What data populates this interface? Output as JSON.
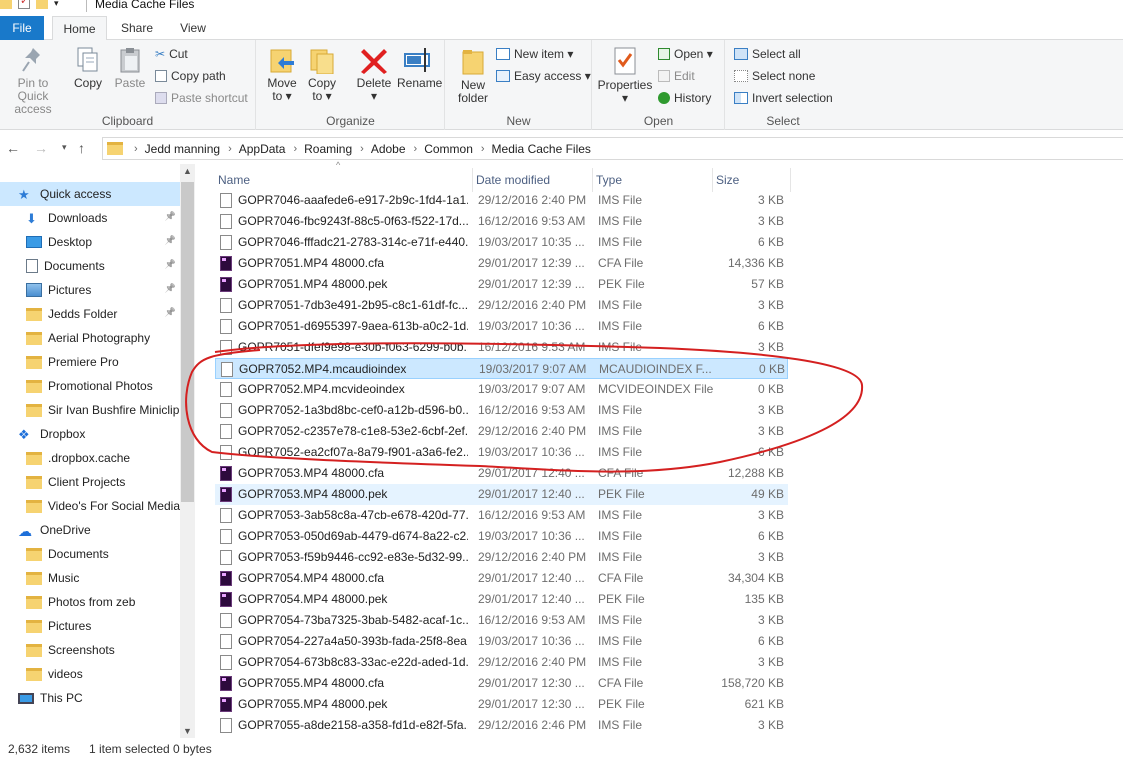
{
  "window": {
    "title": "Media Cache Files"
  },
  "ribbon_tabs": [
    "File",
    "Home",
    "Share",
    "View"
  ],
  "clipboard": {
    "pin_label_1": "Pin to Quick",
    "pin_label_2": "access",
    "copy": "Copy",
    "paste": "Paste",
    "cut": "Cut",
    "copy_path": "Copy path",
    "paste_shortcut": "Paste shortcut",
    "group": "Clipboard"
  },
  "organize": {
    "move_1": "Move",
    "move_2": "to ▾",
    "copy_1": "Copy",
    "copy_2": "to ▾",
    "delete_1": "Delete",
    "delete_2": "▾",
    "rename": "Rename",
    "group": "Organize"
  },
  "new": {
    "new_folder_1": "New",
    "new_folder_2": "folder",
    "new_item": "New item ▾",
    "easy_access": "Easy access ▾",
    "group": "New"
  },
  "open": {
    "properties": "Properties",
    "properties_2": "▾",
    "open": "Open ▾",
    "edit": "Edit",
    "history": "History",
    "group": "Open"
  },
  "select": {
    "select_all": "Select all",
    "select_none": "Select none",
    "invert": "Invert selection",
    "group": "Select"
  },
  "breadcrumb": [
    "Jedd manning",
    "AppData",
    "Roaming",
    "Adobe",
    "Common",
    "Media Cache Files"
  ],
  "sidebar": [
    {
      "label": "Quick access",
      "icon": "star-icon",
      "selected": true,
      "pinned": false
    },
    {
      "label": "Downloads",
      "icon": "download-icon",
      "pinned": true
    },
    {
      "label": "Desktop",
      "icon": "desktop-icon",
      "pinned": true
    },
    {
      "label": "Documents",
      "icon": "documents-icon",
      "pinned": true
    },
    {
      "label": "Pictures",
      "icon": "pictures-icon",
      "pinned": true
    },
    {
      "label": "Jedds Folder",
      "icon": "folder-icon",
      "pinned": true
    },
    {
      "label": "Aerial Photography",
      "icon": "folder-icon"
    },
    {
      "label": "Premiere Pro",
      "icon": "folder-icon"
    },
    {
      "label": "Promotional Photos",
      "icon": "folder-icon"
    },
    {
      "label": "Sir Ivan Bushfire Miniclip",
      "icon": "folder-icon"
    },
    {
      "label": "Dropbox",
      "icon": "dropbox-icon",
      "root": true
    },
    {
      "label": ".dropbox.cache",
      "icon": "folder-icon"
    },
    {
      "label": "Client Projects",
      "icon": "folder-icon"
    },
    {
      "label": "Video's For Social Media",
      "icon": "folder-icon"
    },
    {
      "label": "OneDrive",
      "icon": "cloud-icon",
      "root": true
    },
    {
      "label": "Documents",
      "icon": "folder-icon"
    },
    {
      "label": "Music",
      "icon": "folder-icon"
    },
    {
      "label": "Photos from zeb",
      "icon": "folder-icon"
    },
    {
      "label": "Pictures",
      "icon": "folder-icon"
    },
    {
      "label": "Screenshots",
      "icon": "folder-icon"
    },
    {
      "label": "videos",
      "icon": "folder-icon"
    },
    {
      "label": "This PC",
      "icon": "computer-icon",
      "root": true
    }
  ],
  "columns": {
    "name": "Name",
    "date": "Date modified",
    "type": "Type",
    "size": "Size"
  },
  "files": [
    {
      "name": "GOPR7046-aaafede6-e917-2b9c-1fd4-1a1...",
      "date": "29/12/2016 2:40 PM",
      "type": "IMS File",
      "size": "3 KB",
      "icon": "doc"
    },
    {
      "name": "GOPR7046-fbc9243f-88c5-0f63-f522-17d...",
      "date": "16/12/2016 9:53 AM",
      "type": "IMS File",
      "size": "3 KB",
      "icon": "doc"
    },
    {
      "name": "GOPR7046-fffadc21-2783-314c-e71f-e440...",
      "date": "19/03/2017 10:35 ...",
      "type": "IMS File",
      "size": "6 KB",
      "icon": "doc"
    },
    {
      "name": "GOPR7051.MP4 48000.cfa",
      "date": "29/01/2017 12:39 ...",
      "type": "CFA File",
      "size": "14,336 KB",
      "icon": "premiere"
    },
    {
      "name": "GOPR7051.MP4 48000.pek",
      "date": "29/01/2017 12:39 ...",
      "type": "PEK File",
      "size": "57 KB",
      "icon": "premiere"
    },
    {
      "name": "GOPR7051-7db3e491-2b95-c8c1-61df-fc...",
      "date": "29/12/2016 2:40 PM",
      "type": "IMS File",
      "size": "3 KB",
      "icon": "doc"
    },
    {
      "name": "GOPR7051-d6955397-9aea-613b-a0c2-1d...",
      "date": "19/03/2017 10:36 ...",
      "type": "IMS File",
      "size": "6 KB",
      "icon": "doc"
    },
    {
      "name": "GOPR7051-dfef9e98-e30b-f063-6299-b0b...",
      "date": "16/12/2016 9:53 AM",
      "type": "IMS File",
      "size": "3 KB",
      "icon": "doc"
    },
    {
      "name": "GOPR7052.MP4.mcaudioindex",
      "date": "19/03/2017 9:07 AM",
      "type": "MCAUDIOINDEX F...",
      "size": "0 KB",
      "icon": "doc",
      "state": "selected"
    },
    {
      "name": "GOPR7052.MP4.mcvideoindex",
      "date": "19/03/2017 9:07 AM",
      "type": "MCVIDEOINDEX File",
      "size": "0 KB",
      "icon": "doc"
    },
    {
      "name": "GOPR7052-1a3bd8bc-cef0-a12b-d596-b0...",
      "date": "16/12/2016 9:53 AM",
      "type": "IMS File",
      "size": "3 KB",
      "icon": "doc"
    },
    {
      "name": "GOPR7052-c2357e78-c1e8-53e2-6cbf-2ef...",
      "date": "29/12/2016 2:40 PM",
      "type": "IMS File",
      "size": "3 KB",
      "icon": "doc"
    },
    {
      "name": "GOPR7052-ea2cf07a-8a79-f901-a3a6-fe2...",
      "date": "19/03/2017 10:36 ...",
      "type": "IMS File",
      "size": "6 KB",
      "icon": "doc"
    },
    {
      "name": "GOPR7053.MP4 48000.cfa",
      "date": "29/01/2017 12:40 ...",
      "type": "CFA File",
      "size": "12,288 KB",
      "icon": "premiere"
    },
    {
      "name": "GOPR7053.MP4 48000.pek",
      "date": "29/01/2017 12:40 ...",
      "type": "PEK File",
      "size": "49 KB",
      "icon": "premiere",
      "state": "hover"
    },
    {
      "name": "GOPR7053-3ab58c8a-47cb-e678-420d-77...",
      "date": "16/12/2016 9:53 AM",
      "type": "IMS File",
      "size": "3 KB",
      "icon": "doc"
    },
    {
      "name": "GOPR7053-050d69ab-4479-d674-8a22-c2...",
      "date": "19/03/2017 10:36 ...",
      "type": "IMS File",
      "size": "6 KB",
      "icon": "doc"
    },
    {
      "name": "GOPR7053-f59b9446-cc92-e83e-5d32-99...",
      "date": "29/12/2016 2:40 PM",
      "type": "IMS File",
      "size": "3 KB",
      "icon": "doc"
    },
    {
      "name": "GOPR7054.MP4 48000.cfa",
      "date": "29/01/2017 12:40 ...",
      "type": "CFA File",
      "size": "34,304 KB",
      "icon": "premiere"
    },
    {
      "name": "GOPR7054.MP4 48000.pek",
      "date": "29/01/2017 12:40 ...",
      "type": "PEK File",
      "size": "135 KB",
      "icon": "premiere"
    },
    {
      "name": "GOPR7054-73ba7325-3bab-5482-acaf-1c...",
      "date": "16/12/2016 9:53 AM",
      "type": "IMS File",
      "size": "3 KB",
      "icon": "doc"
    },
    {
      "name": "GOPR7054-227a4a50-393b-fada-25f8-8ea...",
      "date": "19/03/2017 10:36 ...",
      "type": "IMS File",
      "size": "6 KB",
      "icon": "doc"
    },
    {
      "name": "GOPR7054-673b8c83-33ac-e22d-aded-1d...",
      "date": "29/12/2016 2:40 PM",
      "type": "IMS File",
      "size": "3 KB",
      "icon": "doc"
    },
    {
      "name": "GOPR7055.MP4 48000.cfa",
      "date": "29/01/2017 12:30 ...",
      "type": "CFA File",
      "size": "158,720 KB",
      "icon": "premiere"
    },
    {
      "name": "GOPR7055.MP4 48000.pek",
      "date": "29/01/2017 12:30 ...",
      "type": "PEK File",
      "size": "621 KB",
      "icon": "premiere"
    },
    {
      "name": "GOPR7055-a8de2158-a358-fd1d-e82f-5fa...",
      "date": "29/12/2016 2:46 PM",
      "type": "IMS File",
      "size": "3 KB",
      "icon": "doc"
    }
  ],
  "status": {
    "count": "2,632 items",
    "selection": "1 item selected",
    "bytes": "0 bytes"
  },
  "colors": {
    "accent": "#1979ca",
    "selection": "#cce8ff",
    "annotation": "#d42020"
  }
}
